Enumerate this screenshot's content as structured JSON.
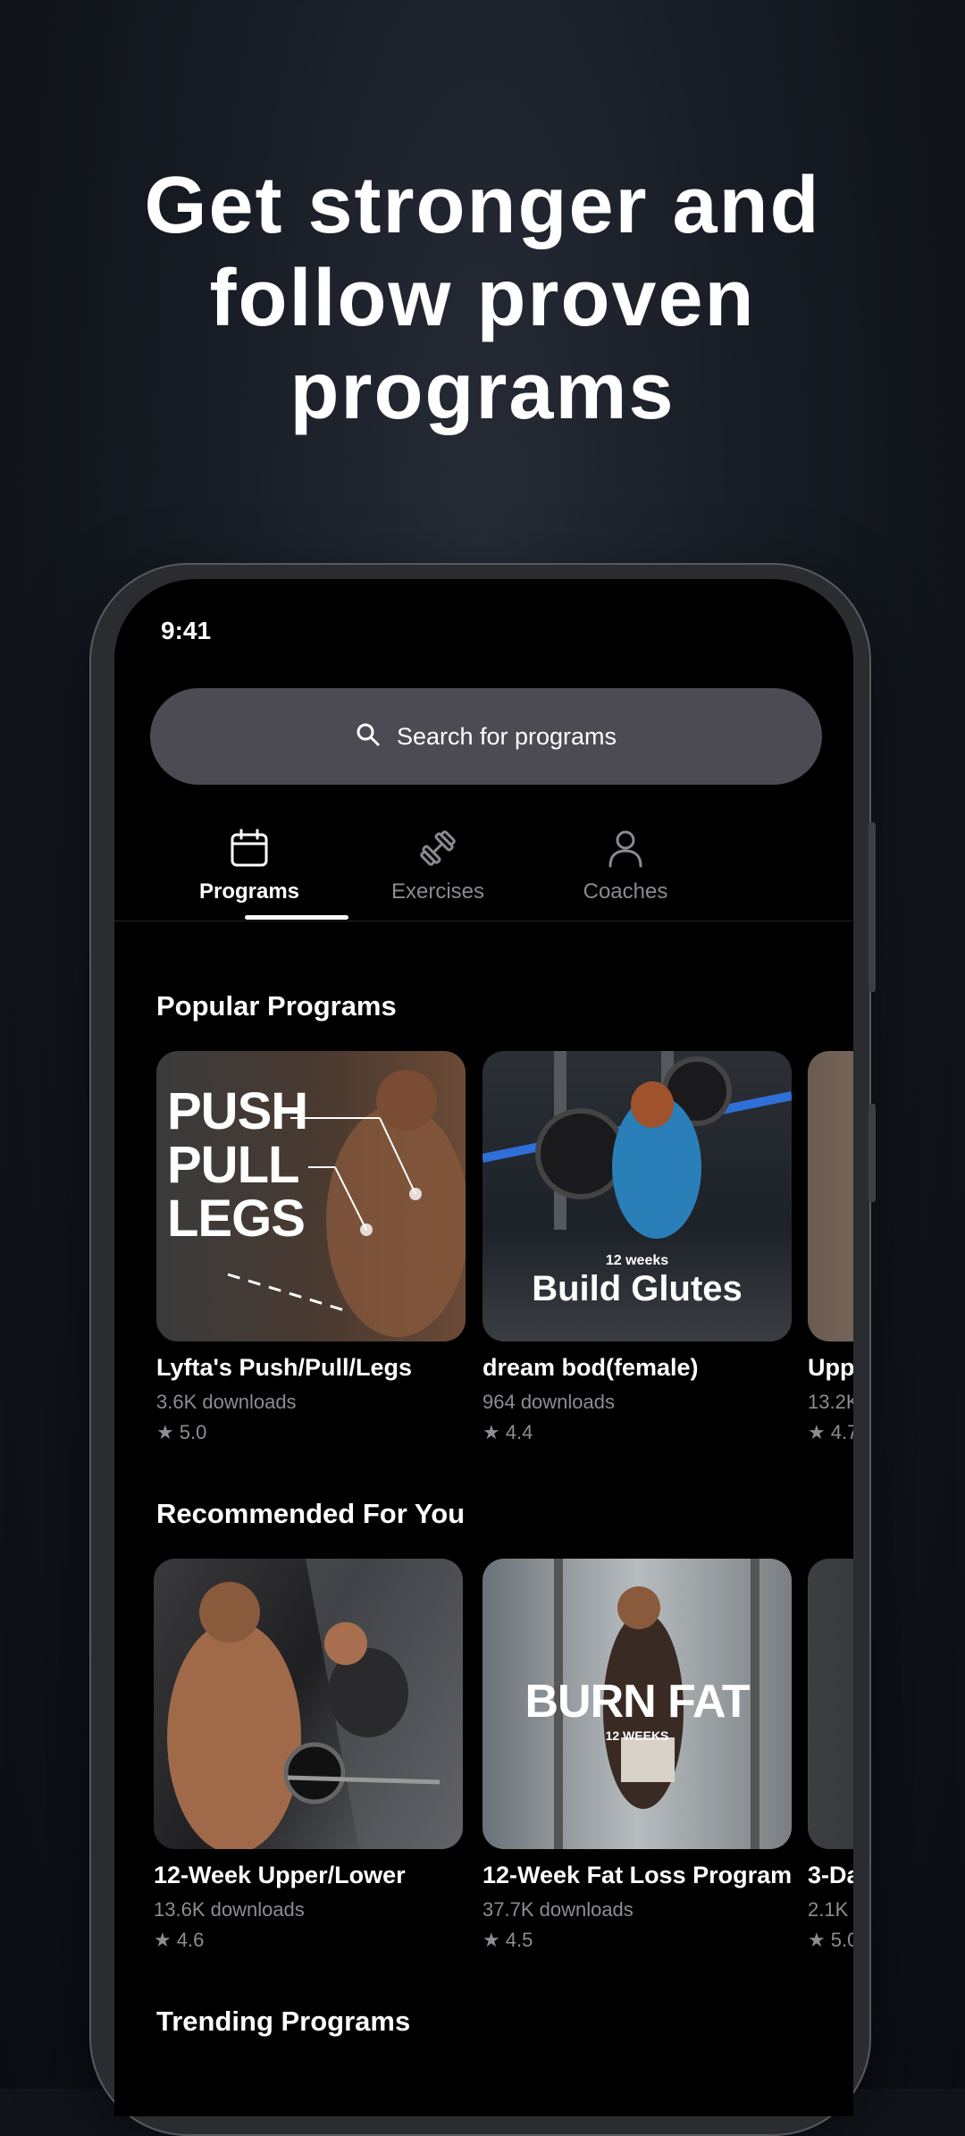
{
  "headline": [
    "Get stronger and",
    "follow proven",
    "programs"
  ],
  "status_time": "9:41",
  "search": {
    "placeholder": "Search for programs"
  },
  "tabs": [
    {
      "label": "Programs",
      "icon": "calendar-icon",
      "active": true
    },
    {
      "label": "Exercises",
      "icon": "dumbbell-icon",
      "active": false
    },
    {
      "label": "Coaches",
      "icon": "person-icon",
      "active": false
    }
  ],
  "sections": {
    "popular": {
      "title": "Popular Programs",
      "cards": [
        {
          "title": "Lyfta's Push/Pull/Legs",
          "downloads": "3.6K downloads",
          "rating": "5.0",
          "overlay": [
            "PUSH",
            "PULL",
            "LEGS"
          ]
        },
        {
          "title": "dream bod(female)",
          "downloads": "964 downloads",
          "rating": "4.4",
          "overlay_small": "12 weeks",
          "overlay_big": "Build Glutes"
        },
        {
          "title": "Upp",
          "downloads": "13.2K",
          "rating": "4.7"
        }
      ]
    },
    "recommended": {
      "title": "Recommended For You",
      "cards": [
        {
          "title": "12-Week Upper/Lower",
          "downloads": "13.6K downloads",
          "rating": "4.6"
        },
        {
          "title": "12-Week Fat Loss Program",
          "downloads": "37.7K downloads",
          "rating": "4.5",
          "overlay_big": "BURN FAT",
          "overlay_small": "12 WEEKS"
        },
        {
          "title": "3-Da",
          "downloads": "2.1K",
          "rating": "5.0"
        }
      ]
    },
    "trending": {
      "title": "Trending Programs"
    }
  },
  "colors": {
    "background": "#161a22",
    "screen": "#000000",
    "search_bg": "#4c4a52",
    "muted": "#8d8d92"
  }
}
